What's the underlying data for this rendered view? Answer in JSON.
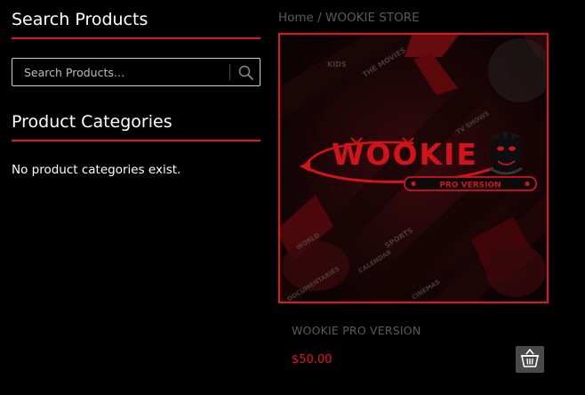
{
  "sidebar": {
    "search_widget": {
      "title": "Search Products",
      "placeholder": "Search Products…"
    },
    "categories_widget": {
      "title": "Product Categories",
      "empty_message": "No product categories exist."
    }
  },
  "breadcrumb": {
    "home": "Home",
    "separator": " / ",
    "current": "WOOKIE STORE"
  },
  "product": {
    "image": {
      "logo_text": "WOOKIE",
      "badge_text": "PRO VERSION",
      "background_words": [
        "KIDS",
        "THE MOVIES",
        "WORLD",
        "SPORTS",
        "DOCUMENTARIES",
        "CALENDAR",
        "CINEMAS",
        "TV SHOWS"
      ]
    },
    "name": "WOOKIE PRO VERSION",
    "price": "$50.00",
    "cart_icon": "basket-icon"
  },
  "colors": {
    "accent": "#e4161d",
    "background": "#000000",
    "muted_text": "#5a5a5a",
    "cart_button": "#4a4a4a"
  }
}
